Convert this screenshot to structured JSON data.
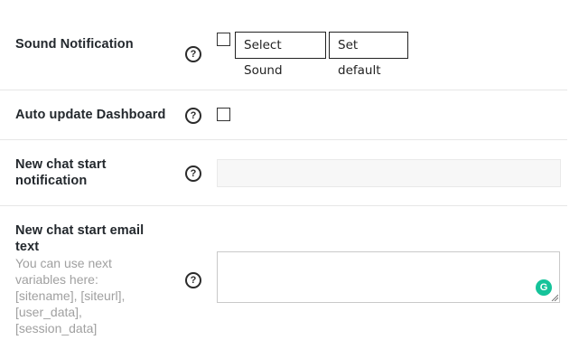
{
  "settings": {
    "sound_notification": {
      "label": "Sound Notification",
      "help_icon": "question-circle-icon",
      "checked": false,
      "select_sound_label": "Select Sound",
      "set_default_label": "Set default"
    },
    "auto_update": {
      "label": "Auto update Dashboard",
      "help_icon": "question-circle-icon",
      "checked": false
    },
    "new_chat_notification": {
      "label_line1": "New chat start",
      "label_line2": "notification",
      "help_icon": "question-circle-icon",
      "value": ""
    },
    "new_chat_email": {
      "label_line1": "New chat start email",
      "label_line2": "text",
      "hint_lines": [
        "You can use next",
        "variables here:",
        "[sitename], [siteurl],",
        "[user_data],",
        "[session_data]"
      ],
      "help_icon": "question-circle-icon",
      "value": "",
      "grammarly_icon": "grammarly-icon"
    }
  },
  "help_glyph": "?",
  "grammarly_glyph": "G",
  "colors": {
    "grammarly": "#15c39a",
    "divider": "#e6e6e6",
    "hint_text": "#a0a0a0"
  }
}
